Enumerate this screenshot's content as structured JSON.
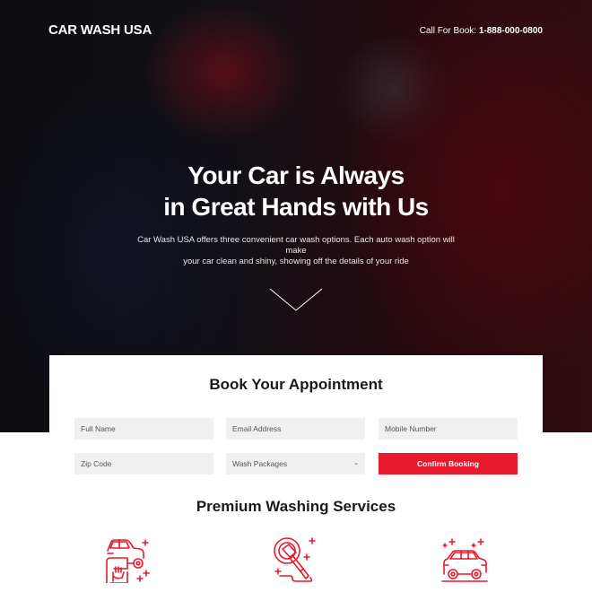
{
  "header": {
    "brand": "CAR WASH USA",
    "phone_label": "Call For Book:",
    "phone_number": "1-888-000-0800"
  },
  "hero": {
    "headline_line1": "Your Car is Always",
    "headline_line2": "in Great Hands with Us",
    "subtext_line1": "Car Wash USA offers three convenient car wash options. Each auto wash option will make",
    "subtext_line2": "your car clean and shiny, showing off the details of your ride",
    "scroll_icon": "chevron-down-icon"
  },
  "booking": {
    "title": "Book Your Appointment",
    "fields": {
      "full_name": {
        "placeholder": "Full Name",
        "value": ""
      },
      "email": {
        "placeholder": "Email Address",
        "value": ""
      },
      "mobile": {
        "placeholder": "Mobile Number",
        "value": ""
      },
      "zip": {
        "placeholder": "Zip Code",
        "value": ""
      }
    },
    "package_select": {
      "selected": "Wash Packages"
    },
    "confirm_label": "Confirm Booking"
  },
  "services": {
    "title": "Premium Washing Services",
    "icons": [
      "car-detailing-icon",
      "car-polisher-icon",
      "clean-car-icon"
    ]
  },
  "colors": {
    "accent": "#e8192c",
    "field_bg": "#f0f0f0",
    "heading": "#1a1a1a"
  }
}
